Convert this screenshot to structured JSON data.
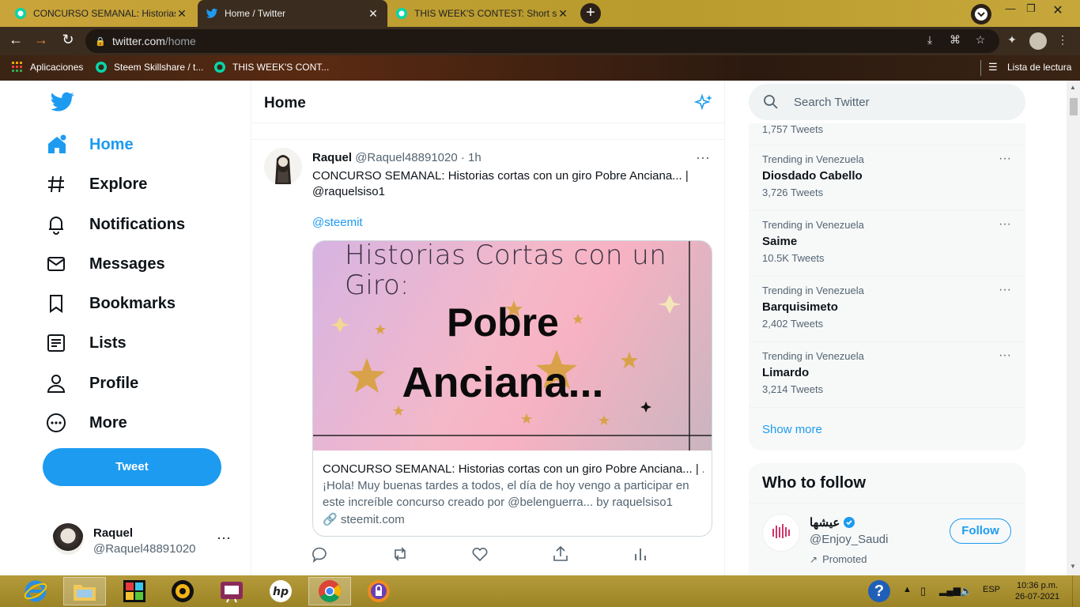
{
  "browser": {
    "tabs": [
      {
        "title": "CONCURSO SEMANAL: Historias",
        "active": false
      },
      {
        "title": "Home / Twitter",
        "active": true
      },
      {
        "title": "THIS WEEK'S CONTEST: Short sto",
        "active": false
      }
    ],
    "url_host": "twitter.com",
    "url_path": "/home",
    "bookmarks": [
      {
        "label": "Aplicaciones"
      },
      {
        "label": "Steem Skillshare / t..."
      },
      {
        "label": "THIS WEEK'S CONT..."
      }
    ],
    "reading_list": "Lista de lectura"
  },
  "nav": {
    "items": [
      {
        "label": "Home",
        "icon": "home-icon",
        "active": true
      },
      {
        "label": "Explore",
        "icon": "hashtag-icon"
      },
      {
        "label": "Notifications",
        "icon": "bell-icon"
      },
      {
        "label": "Messages",
        "icon": "envelope-icon"
      },
      {
        "label": "Bookmarks",
        "icon": "bookmark-icon"
      },
      {
        "label": "Lists",
        "icon": "list-icon"
      },
      {
        "label": "Profile",
        "icon": "person-icon"
      },
      {
        "label": "More",
        "icon": "more-circle-icon"
      }
    ],
    "tweet_button": "Tweet",
    "account": {
      "name": "Raquel",
      "handle": "@Raquel48891020"
    }
  },
  "timeline": {
    "title": "Home",
    "tweet": {
      "author": "Raquel",
      "handle": "@Raquel48891020",
      "time": "· 1h",
      "text_line1": "CONCURSO SEMANAL: Historias cortas con un giro Pobre Anciana... |",
      "text_line2": "@raquelsiso1",
      "mention": "@steemit",
      "card": {
        "image_line1": "Historias Cortas con un",
        "image_line2": "Giro:",
        "image_title1": "Pobre",
        "image_title2": "Anciana...",
        "title": "CONCURSO SEMANAL: Historias cortas con un giro Pobre Anciana... | ...",
        "desc_line1": "¡Hola! Muy buenas tardes a todos, el día de hoy vengo a participar en",
        "desc_line2": "este increíble concurso creado por @belenguerra... by raquelsiso1",
        "domain": "steemit.com"
      }
    }
  },
  "sidebar": {
    "search_placeholder": "Search Twitter",
    "partial_count": "1,757 Tweets",
    "trends": [
      {
        "context": "Trending in Venezuela",
        "name": "Diosdado Cabello",
        "count": "3,726 Tweets"
      },
      {
        "context": "Trending in Venezuela",
        "name": "Saime",
        "count": "10.5K Tweets"
      },
      {
        "context": "Trending in Venezuela",
        "name": "Barquisimeto",
        "count": "2,402 Tweets"
      },
      {
        "context": "Trending in Venezuela",
        "name": "Limardo",
        "count": "3,214 Tweets"
      }
    ],
    "show_more": "Show more",
    "who_to_follow": {
      "title": "Who to follow",
      "name": "عيشها",
      "handle": "@Enjoy_Saudi",
      "promoted": "Promoted",
      "follow": "Follow"
    }
  },
  "taskbar": {
    "lang": "ESP",
    "time": "10:36 p.m.",
    "date": "26-07-2021"
  },
  "colors": {
    "accent": "#1d9bf0",
    "text": "#0f1419",
    "muted": "#536471"
  }
}
